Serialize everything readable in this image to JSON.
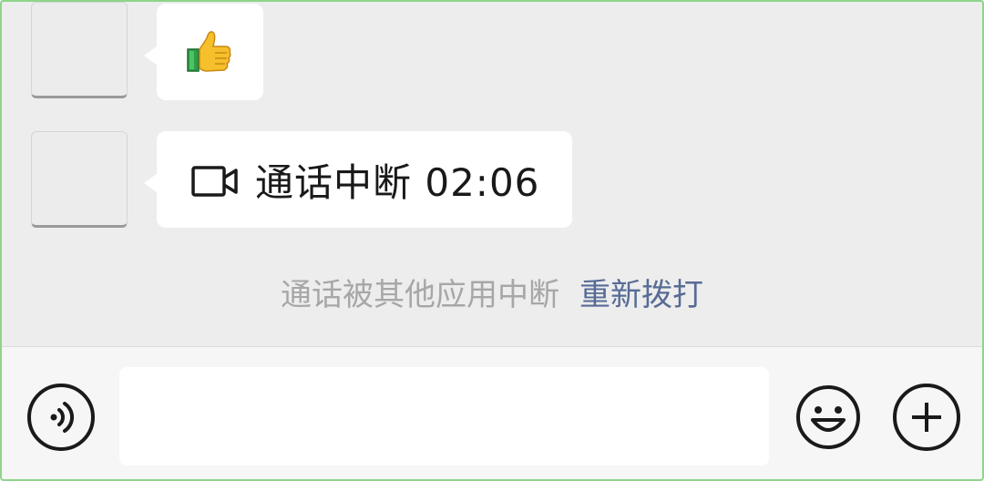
{
  "messages": [
    {
      "type": "sticker",
      "sticker": "thumbs-up"
    },
    {
      "type": "video-call",
      "icon": "video-camera-icon",
      "text": "通话中断 02:06"
    }
  ],
  "system_notice": {
    "text": "通话被其他应用中断",
    "action_label": "重新拨打"
  },
  "input_bar": {
    "voice_icon": "voice-icon",
    "input_value": "",
    "emoji_icon": "emoji-icon",
    "more_icon": "plus-icon"
  },
  "colors": {
    "chat_background": "#ededed",
    "bubble_background": "#ffffff",
    "link": "#576b95",
    "notice_text": "#a7a7a7",
    "input_bar_background": "#f6f6f6"
  }
}
